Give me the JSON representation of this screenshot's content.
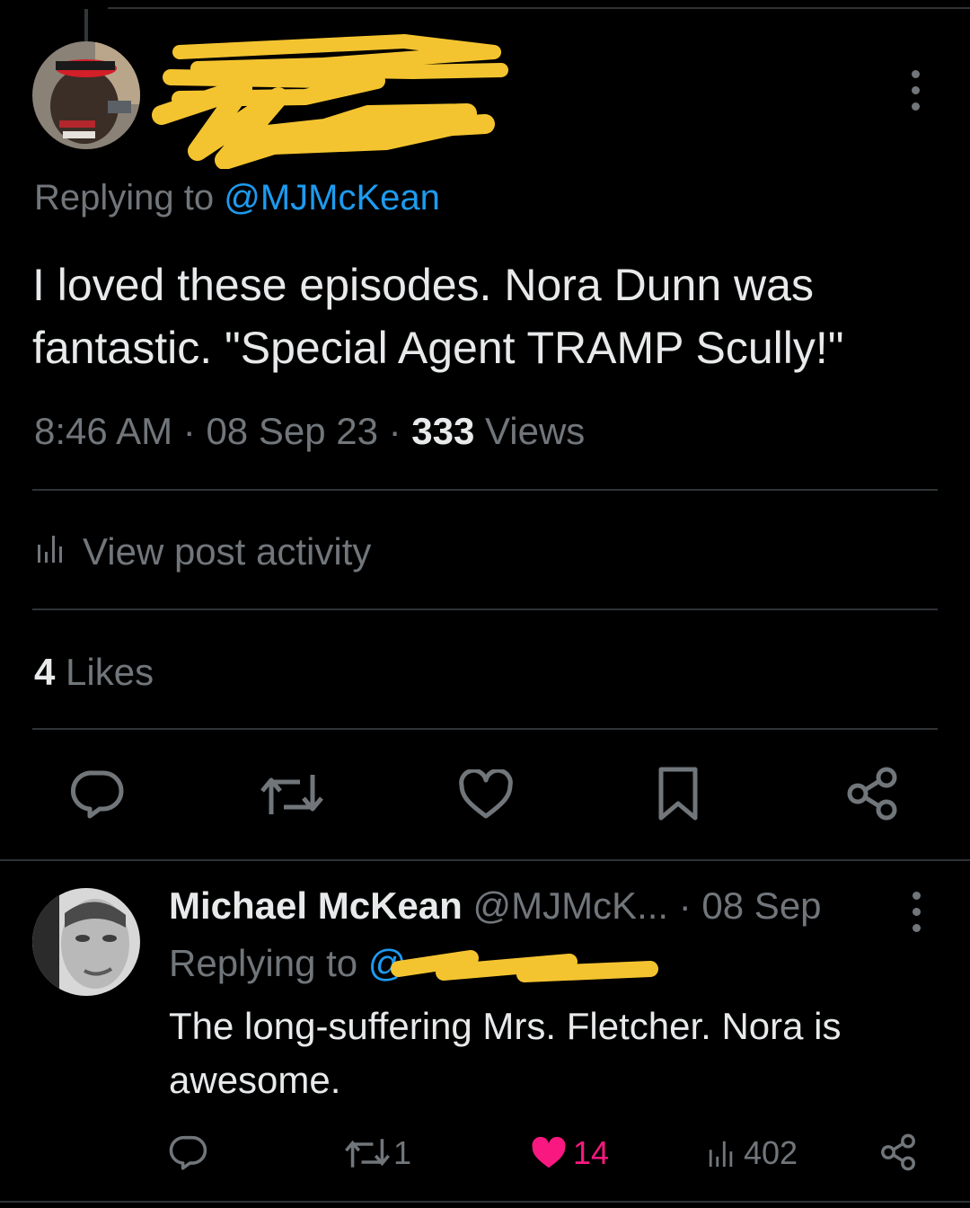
{
  "main_tweet": {
    "replying_prefix": "Replying to ",
    "replying_handle": "@MJMcKean",
    "text": "I loved these episodes. Nora Dunn was fantastic. \"Special Agent TRAMP Scully!\"",
    "time": "8:46 AM",
    "date": "08 Sep 23",
    "views_count": "333",
    "views_label": " Views",
    "activity_label": "View post activity",
    "likes_count": "4",
    "likes_label": " Likes"
  },
  "reply_tweet": {
    "author_name": "Michael McKean",
    "author_handle": "@MJMcK...",
    "date": "08 Sep",
    "replying_prefix": "Replying to ",
    "replying_handle_visible": "@",
    "text": "The long-suffering Mrs. Fletcher. Nora is awesome.",
    "retweet_count": "1",
    "like_count": "14",
    "view_count": "402"
  },
  "colors": {
    "background": "#000000",
    "text_primary": "#e7e9ea",
    "text_secondary": "#71767b",
    "link": "#1d9bf0",
    "like_active": "#f91880",
    "divider": "#2f3336",
    "redaction": "#f4c430"
  },
  "icons": [
    "more-icon",
    "reply-icon",
    "retweet-icon",
    "like-icon",
    "bookmark-icon",
    "share-icon",
    "analytics-icon"
  ]
}
